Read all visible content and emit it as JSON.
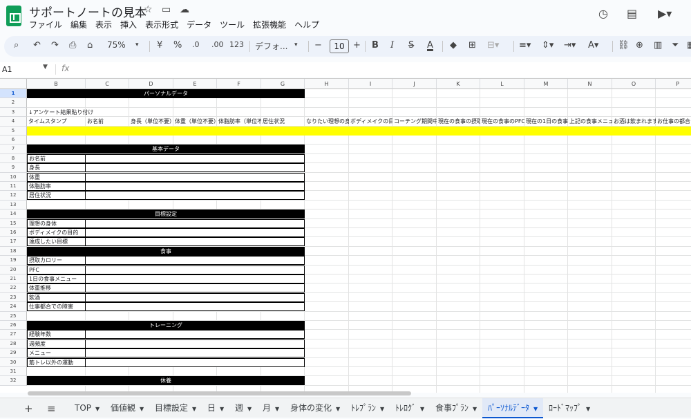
{
  "app": {
    "title": "サポートノートの見本",
    "menu": [
      "ファイル",
      "編集",
      "表示",
      "挿入",
      "表示形式",
      "データ",
      "ツール",
      "拡張機能",
      "ヘルプ"
    ]
  },
  "toolbar": {
    "zoom": "75%",
    "currency": "¥",
    "percent": "%",
    "dec_decrease": ".0",
    "dec_increase": ".00",
    "number_format": "123",
    "font": "デフォ...",
    "font_size": "10"
  },
  "formula_bar": {
    "cell_ref": "A1",
    "fx": "fx"
  },
  "columns": [
    "B",
    "C",
    "D",
    "E",
    "F",
    "G",
    "H",
    "I",
    "J",
    "K",
    "L",
    "M",
    "N",
    "O",
    "P"
  ],
  "rows": [
    "1",
    "2",
    "3",
    "4",
    "5",
    "6",
    "7",
    "8",
    "9",
    "10",
    "11",
    "12",
    "13",
    "14",
    "15",
    "16",
    "17",
    "18",
    "19",
    "20",
    "21",
    "22",
    "23",
    "24",
    "25",
    "26",
    "27",
    "28",
    "29",
    "30",
    "31",
    "32"
  ],
  "sheet": {
    "title_header": "パーソナルデータ",
    "note": "↓アンケート結果貼り付け",
    "row4": [
      "タイムスタンプ",
      "お名前",
      "身長（単位不要）",
      "体重（単位不要）",
      "体脂肪率（単位不要）",
      "居住状況",
      "なりたい理想の身体",
      "ボディメイクの目的",
      "コーチング期間中に",
      "現在の食事の摂取",
      "現在の食事のPFC",
      "現在の1日の食事",
      "上記の食事メニュー",
      "お酒は飲まれますか",
      "お仕事の都合"
    ],
    "sections": [
      {
        "title": "基本データ",
        "items": [
          "お名前",
          "身長",
          "体重",
          "体脂肪率",
          "居住状況"
        ]
      },
      {
        "title": "目標設定",
        "items": [
          "理想の身体",
          "ボディメイクの目的",
          "達成したい目標"
        ]
      },
      {
        "title": "食事",
        "items": [
          "摂取カロリー",
          "PFC",
          "1日の食事メニュー",
          "体重推移",
          "飲酒",
          "仕事都合での障害"
        ]
      },
      {
        "title": "トレーニング",
        "items": [
          "経験年数",
          "週頻度",
          "メニュー",
          "筋トレ以外の運動"
        ]
      },
      {
        "title": "休養",
        "items": []
      }
    ]
  },
  "tabs": [
    {
      "label": "TOP",
      "active": false
    },
    {
      "label": "価値観",
      "active": false
    },
    {
      "label": "目標設定",
      "active": false
    },
    {
      "label": "日",
      "active": false
    },
    {
      "label": "週",
      "active": false
    },
    {
      "label": "月",
      "active": false
    },
    {
      "label": "身体の変化",
      "active": false
    },
    {
      "label": "ﾄﾚﾌﾟﾗﾝ",
      "active": false
    },
    {
      "label": "ﾄﾚﾛｸﾞ",
      "active": false
    },
    {
      "label": "食事ﾌﾟﾗﾝ",
      "active": false
    },
    {
      "label": "ﾊﾟｰｿﾅﾙﾃﾞｰﾀ",
      "active": true
    },
    {
      "label": "ﾛｰﾄﾞﾏｯﾌﾟ",
      "active": false
    }
  ]
}
